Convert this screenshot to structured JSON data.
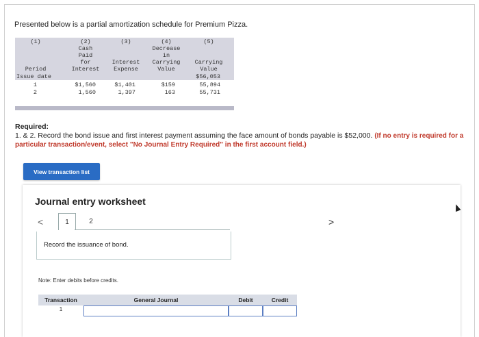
{
  "intro": "Presented below is a partial amortization schedule for Premium Pizza.",
  "schedule": {
    "col_numbers": [
      "(1)",
      "(2)",
      "(3)",
      "(4)",
      "(5)"
    ],
    "headers": {
      "c1": [
        "Period"
      ],
      "c2": [
        "Cash",
        "Paid",
        "for",
        "Interest"
      ],
      "c3": [
        "Interest",
        "Expense"
      ],
      "c4": [
        "Decrease",
        "in",
        "Carrying",
        "Value"
      ],
      "c5": [
        "Carrying",
        "Value"
      ]
    },
    "rows": [
      {
        "period": "Issue date",
        "cash": "",
        "interest": "",
        "decrease": "",
        "carrying": "$56,053"
      },
      {
        "period": "1",
        "cash": "$1,560",
        "interest": "$1,401",
        "decrease": "$159",
        "carrying": "55,894"
      },
      {
        "period": "2",
        "cash": "1,560",
        "interest": "1,397",
        "decrease": "163",
        "carrying": "55,731"
      }
    ]
  },
  "required": {
    "title": "Required:",
    "body": "1. & 2. Record the bond issue and first interest payment assuming the face amount of bonds payable is $52,000.",
    "note": "(If no entry is required for a particular transaction/event, select \"No Journal Entry Required\" in the first account field.)"
  },
  "view_button": "View transaction list",
  "worksheet": {
    "title": "Journal entry worksheet",
    "prev": "<",
    "next": ">",
    "tabs": [
      "1",
      "2"
    ],
    "record_text": "Record the issuance of bond.",
    "note": "Note: Enter debits before credits.",
    "columns": [
      "Transaction",
      "General Journal",
      "Debit",
      "Credit"
    ],
    "row_num": "1"
  },
  "icons": {
    "prev": "chevron-left-icon",
    "next": "chevron-right-icon",
    "cursor": "mouse-cursor-icon"
  },
  "colors": {
    "accent": "#2a6cc4",
    "required_red": "#c0392b",
    "table_band": "#d6d6e0"
  }
}
